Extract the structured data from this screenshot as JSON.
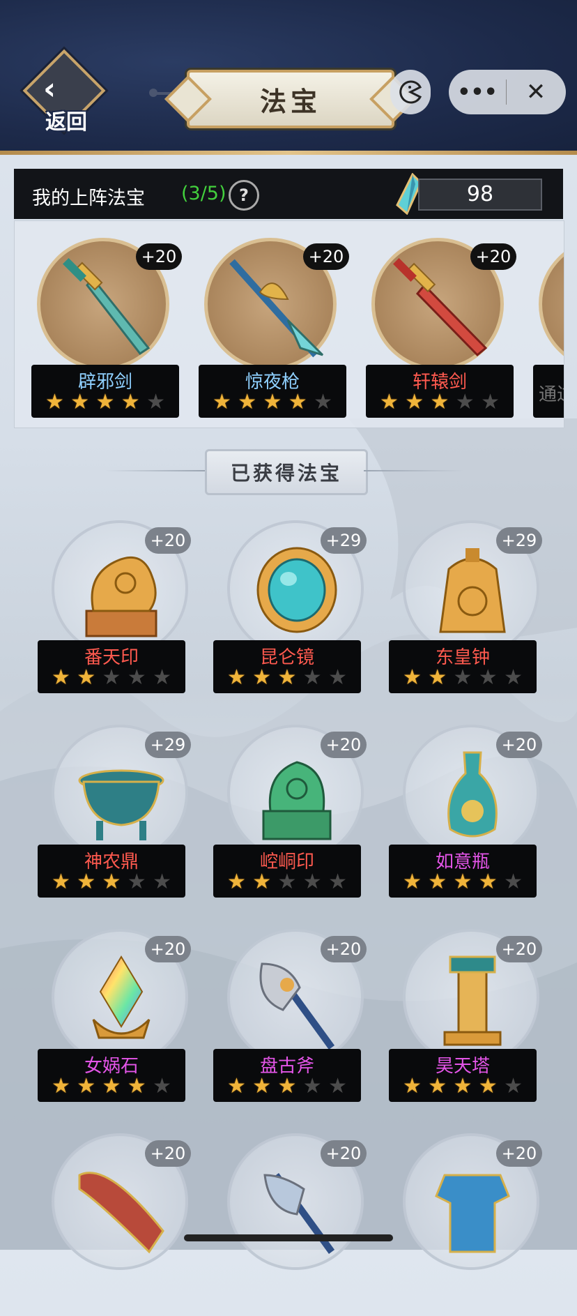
{
  "header": {
    "back_label": "返回",
    "title": "法宝"
  },
  "equipped": {
    "title": "我的上阵法宝",
    "count": "(3/5)",
    "help": "?",
    "currency": "98",
    "items": [
      {
        "name": "辟邪剑",
        "level": "+20",
        "stars": 4,
        "color": "#8fd0ff"
      },
      {
        "name": "惊夜枪",
        "level": "+20",
        "stars": 4,
        "color": "#8fd0ff"
      },
      {
        "name": "轩辕剑",
        "level": "+20",
        "stars": 3,
        "color": "#ff5a4f"
      }
    ],
    "locked_hint": "通过"
  },
  "owned_section_title": "已获得法宝",
  "owned": [
    {
      "name": "番天印",
      "level": "+20",
      "stars": 2,
      "color": "#ff5a4f"
    },
    {
      "name": "昆仑镜",
      "level": "+29",
      "stars": 3,
      "color": "#ff5a4f"
    },
    {
      "name": "东皇钟",
      "level": "+29",
      "stars": 2,
      "color": "#ff5a4f"
    },
    {
      "name": "神农鼎",
      "level": "+29",
      "stars": 3,
      "color": "#ff5a4f"
    },
    {
      "name": "崆峒印",
      "level": "+20",
      "stars": 2,
      "color": "#ff5a4f"
    },
    {
      "name": "如意瓶",
      "level": "+20",
      "stars": 4,
      "color": "#e455e8"
    },
    {
      "name": "女娲石",
      "level": "+20",
      "stars": 4,
      "color": "#e455e8"
    },
    {
      "name": "盘古斧",
      "level": "+20",
      "stars": 3,
      "color": "#e455e8"
    },
    {
      "name": "昊天塔",
      "level": "+20",
      "stars": 4,
      "color": "#e455e8"
    },
    {
      "name": "",
      "level": "+20",
      "stars": 0,
      "color": "#e455e8"
    },
    {
      "name": "",
      "level": "+20",
      "stars": 0,
      "color": "#e455e8"
    },
    {
      "name": "",
      "level": "+20",
      "stars": 0,
      "color": "#e455e8"
    }
  ]
}
